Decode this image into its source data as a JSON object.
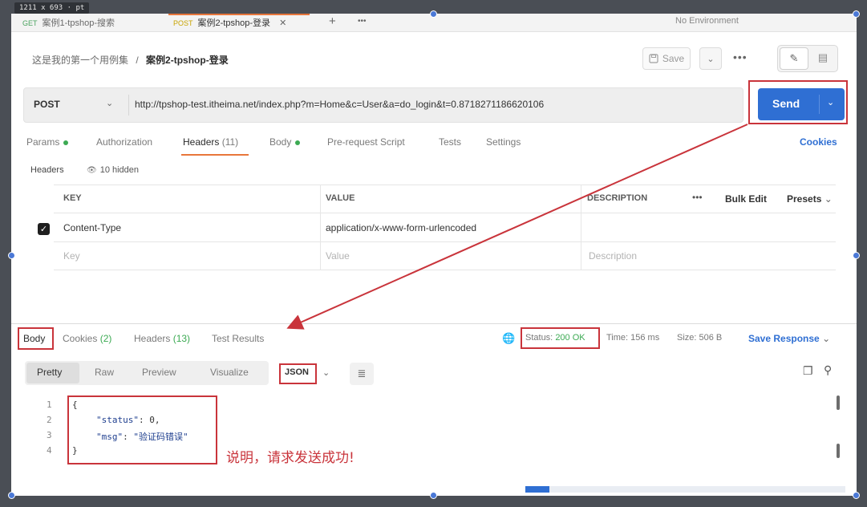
{
  "overlay": {
    "dimension_label": "1211 x 693 · pt"
  },
  "tabs": [
    {
      "method": "GET",
      "title": "案例1-tpshop-搜索"
    },
    {
      "method": "POST",
      "title": "案例2-tpshop-登录"
    }
  ],
  "tabbar": {
    "close": "✕",
    "add": "+",
    "more": "•••",
    "environment": "No Environment"
  },
  "breadcrumb": {
    "collection": "这是我的第一个用例集",
    "separator": "/",
    "request": "案例2-tpshop-登录"
  },
  "toolbar": {
    "save_label": "Save",
    "save_dd": "⌄",
    "more": "•••",
    "edit_icon": "✎",
    "doc_icon": "▤"
  },
  "request": {
    "method": "POST",
    "method_dd": "⌄",
    "url": "http://tpshop-test.itheima.net/index.php?m=Home&c=User&a=do_login&t=0.8718271186620106",
    "send_label": "Send",
    "send_dd": "⌄"
  },
  "request_tabs": {
    "params": "Params",
    "authorization": "Authorization",
    "headers": "Headers",
    "headers_count": "(11)",
    "body": "Body",
    "prerequest": "Pre-request Script",
    "tests": "Tests",
    "settings": "Settings",
    "cookies": "Cookies"
  },
  "headers_section": {
    "label": "Headers",
    "hidden_icon": "👁",
    "hidden_label": "10 hidden"
  },
  "headers_table": {
    "columns": {
      "key": "KEY",
      "value": "VALUE",
      "description": "DESCRIPTION"
    },
    "more": "•••",
    "bulk_edit": "Bulk Edit",
    "presets": "Presets",
    "presets_dd": "⌄",
    "rows": [
      {
        "checked": "✓",
        "key": "Content-Type",
        "value": "application/x-www-form-urlencoded"
      }
    ],
    "placeholder": {
      "key": "Key",
      "value": "Value",
      "description": "Description"
    }
  },
  "response": {
    "tabs": {
      "body": "Body",
      "cookies": "Cookies",
      "cookies_count": "(2)",
      "headers": "Headers",
      "headers_count": "(13)",
      "tests": "Test Results"
    },
    "globe": "🌐",
    "status_label": "Status:",
    "status_value": "200 OK",
    "time": "Time: 156 ms",
    "size": "Size: 506 B",
    "save_response": "Save Response",
    "save_dd": "⌄",
    "formats": [
      "Pretty",
      "Raw",
      "Preview",
      "Visualize"
    ],
    "format_selected": "JSON",
    "format_dd": "⌄",
    "wrap_icon": "≣",
    "copy_icon": "❐",
    "search_icon": "⚲",
    "line_numbers": [
      "1",
      "2",
      "3",
      "4"
    ],
    "code": {
      "open": "{",
      "status_key": "\"status\"",
      "status_val": ": 0,",
      "msg_key": "\"msg\"",
      "msg_sep": ": ",
      "msg_val": "\"验证码错误\"",
      "close": "}"
    },
    "note": "说明，请求发送成功!"
  }
}
